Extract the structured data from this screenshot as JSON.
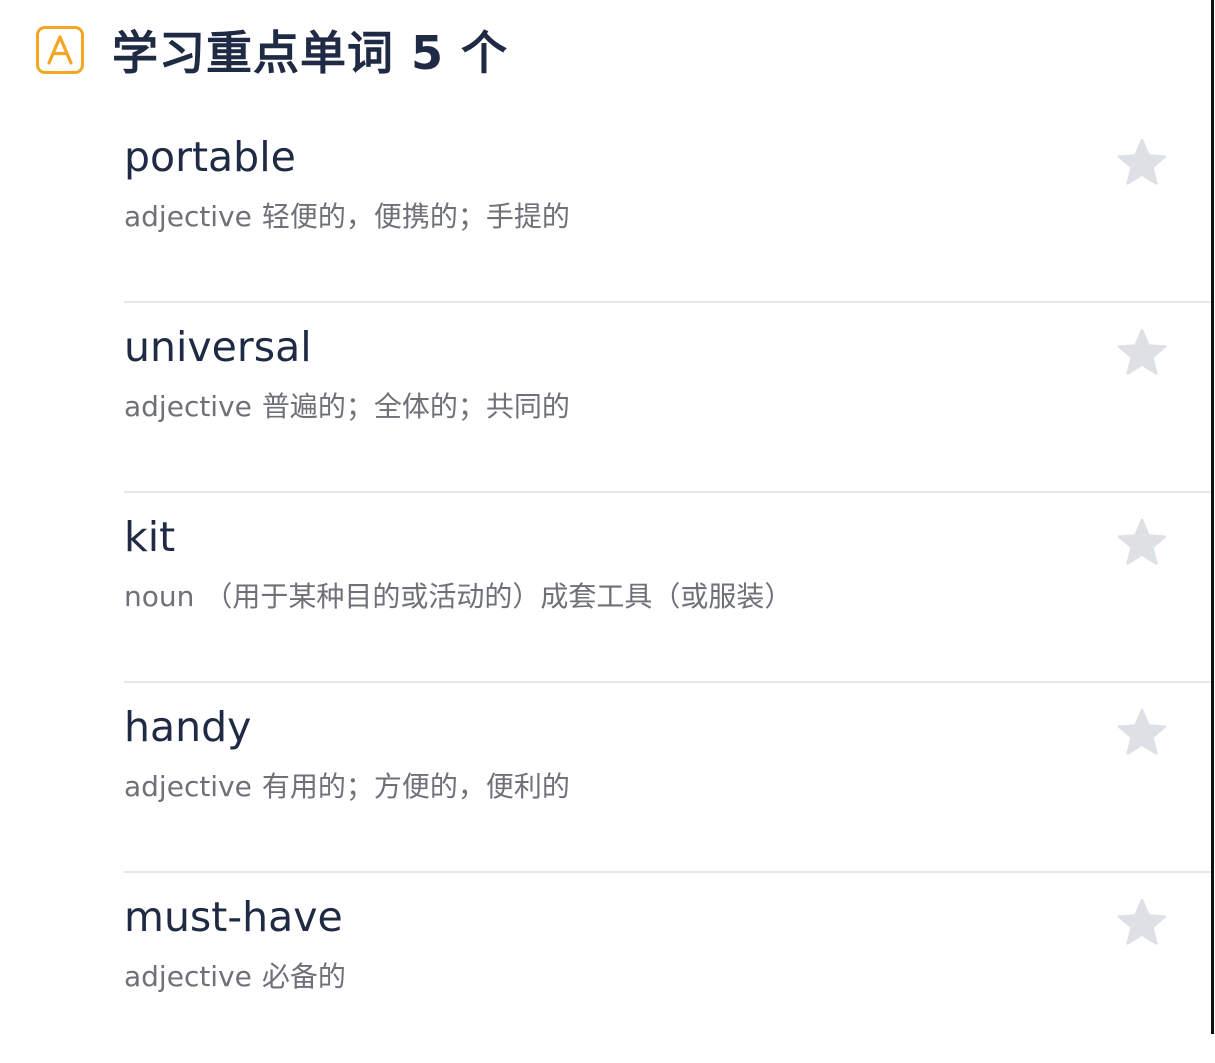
{
  "header": {
    "badge_icon": "letter-a-icon",
    "title": "学习重点单词 5 个",
    "accent_color": "#f5a623"
  },
  "words": [
    {
      "word": "portable",
      "pos": "adjective",
      "definition": "轻便的，便携的；手提的",
      "favorite_icon": "star-icon"
    },
    {
      "word": "universal",
      "pos": "adjective",
      "definition": "普遍的；全体的；共同的",
      "favorite_icon": "star-icon"
    },
    {
      "word": "kit",
      "pos": "noun",
      "definition": "（用于某种目的或活动的）成套工具（或服装）",
      "favorite_icon": "star-icon"
    },
    {
      "word": "handy",
      "pos": "adjective",
      "definition": "有用的；方便的，便利的",
      "favorite_icon": "star-icon"
    },
    {
      "word": "must-have",
      "pos": "adjective",
      "definition": "必备的",
      "favorite_icon": "star-icon"
    }
  ],
  "colors": {
    "title": "#1f2a44",
    "definition": "#6e7178",
    "star": "#dde1e6",
    "divider": "#e6e8ec"
  }
}
